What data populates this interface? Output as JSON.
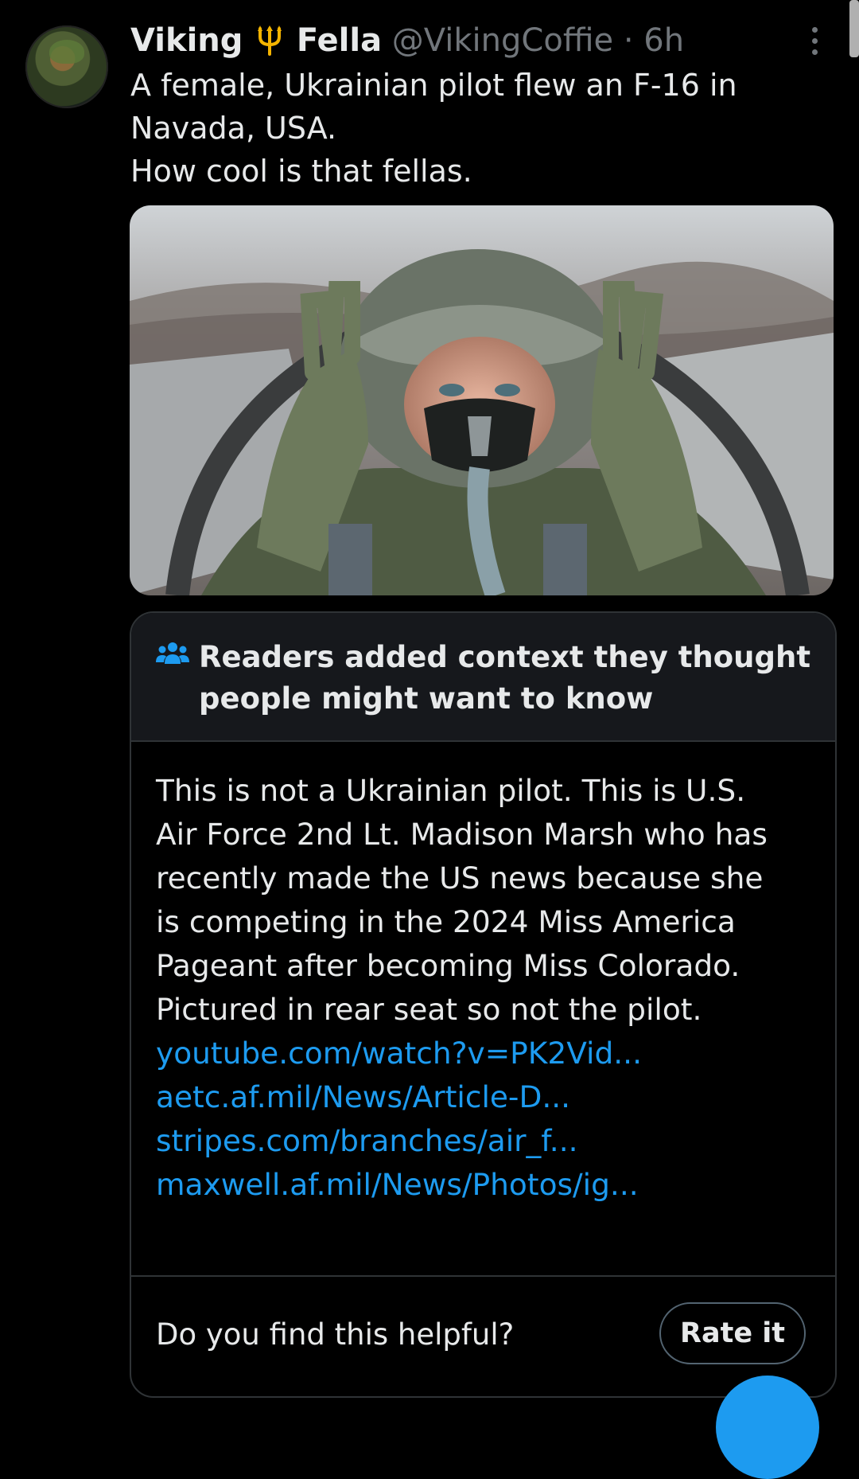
{
  "tweet": {
    "display_name_part1": "Viking",
    "display_name_emoji": "trident-icon",
    "display_name_part2": "Fella",
    "handle_time": "@VikingCoffie · 6h",
    "text_lines": [
      "A female, Ukrainian pilot flew an F-16 in",
      "Navada, USA.",
      "How cool is that fellas."
    ],
    "image": "photo of pilot in fighter jet cockpit wearing helmet and oxygen mask"
  },
  "community_note": {
    "title_lines": [
      "Readers added context they thought",
      "people might want to know"
    ],
    "body_lines": [
      "This is not a Ukrainian pilot. This is U.S.",
      "Air Force 2nd Lt. Madison Marsh who has",
      "recently made the US news because she",
      "is competing in the 2024 Miss America",
      "Pageant after becoming Miss Colorado.",
      "Pictured in rear seat so not the pilot."
    ],
    "links": [
      "youtube.com/watch?v=PK2Vid...",
      "aetc.af.mil/News/Article-D...",
      "stripes.com/branches/air_f...",
      "maxwell.af.mil/News/Photos/ig..."
    ],
    "helpful_prompt": "Do you find this helpful?",
    "rate_label": "Rate it"
  },
  "colors": {
    "background": "#000000",
    "text": "#e7e9ea",
    "secondary_text": "#71767b",
    "link": "#1d9bf0",
    "note_header_bg": "#16181c",
    "trident": "#f4b400"
  }
}
